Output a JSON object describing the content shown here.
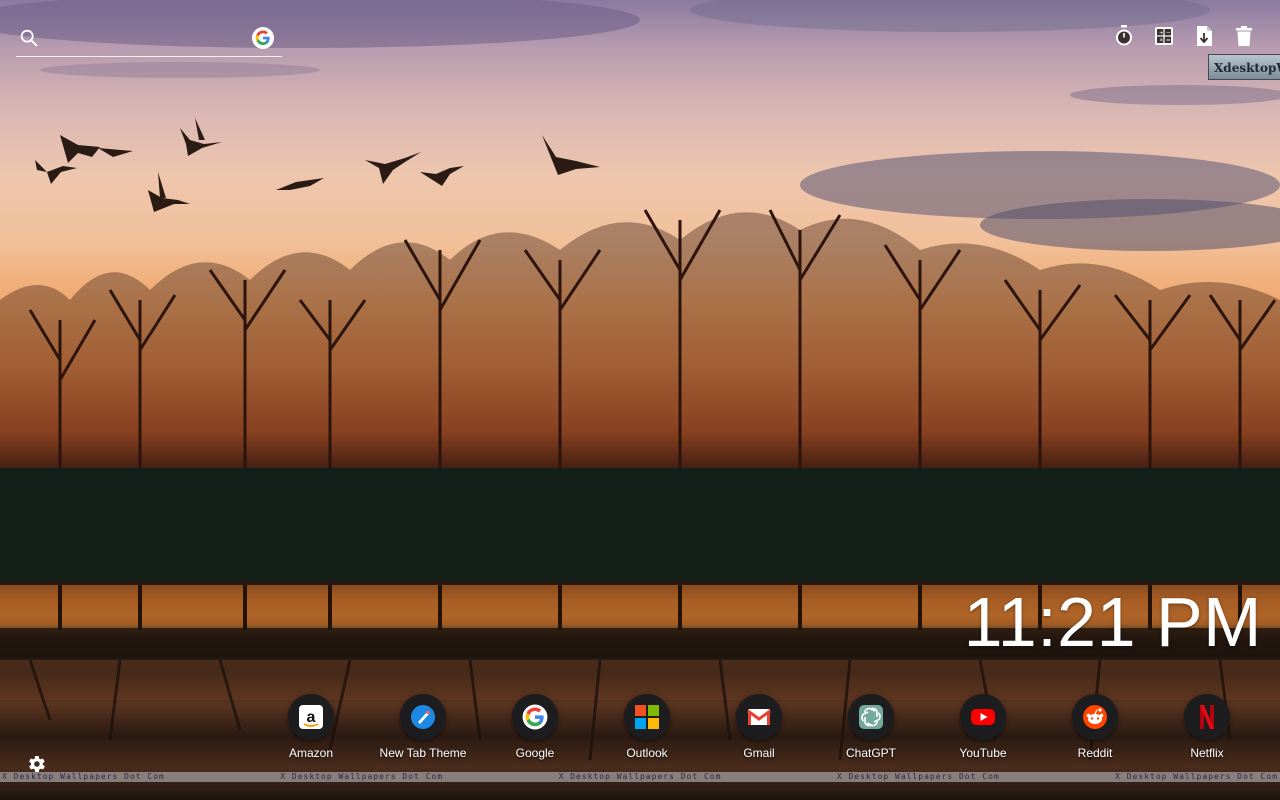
{
  "search": {
    "placeholder": ""
  },
  "tools": [
    {
      "icon": "timer-icon"
    },
    {
      "icon": "calculator-icon"
    },
    {
      "icon": "file-download-icon"
    },
    {
      "icon": "trash-icon"
    }
  ],
  "watermark": {
    "badge": "XdesktopWall",
    "strip": "X Desktop Wallpapers Dot Com"
  },
  "clock": {
    "time": "11:21 PM"
  },
  "shortcuts": [
    {
      "label": "Amazon",
      "icon": "amazon-icon"
    },
    {
      "label": "New Tab Theme",
      "icon": "new-tab-theme-icon"
    },
    {
      "label": "Google",
      "icon": "google-icon"
    },
    {
      "label": "Outlook",
      "icon": "microsoft-icon"
    },
    {
      "label": "Gmail",
      "icon": "gmail-icon"
    },
    {
      "label": "ChatGPT",
      "icon": "chatgpt-icon"
    },
    {
      "label": "YouTube",
      "icon": "youtube-icon"
    },
    {
      "label": "Reddit",
      "icon": "reddit-icon"
    },
    {
      "label": "Netflix",
      "icon": "netflix-icon"
    }
  ],
  "colors": {
    "amazon": "#ffffff",
    "google_blue": "#4285F4",
    "google_red": "#EA4335",
    "google_yellow": "#FBBC05",
    "google_green": "#34A853",
    "youtube": "#FF0000",
    "reddit": "#FF4500",
    "netflix": "#E50914",
    "chatgpt": "#74AA9C"
  }
}
